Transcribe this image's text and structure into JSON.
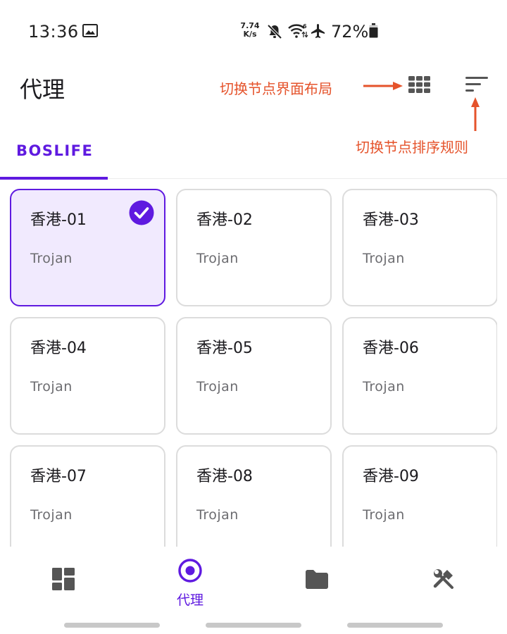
{
  "status_bar": {
    "time": "13:36",
    "net_speed_value": "7.74",
    "net_speed_unit": "K/s",
    "wifi_badge": "6",
    "battery_percent": "72%",
    "icons": [
      "gallery-icon",
      "mute-icon",
      "wifi-icon",
      "airplane-icon",
      "battery-icon"
    ]
  },
  "app_bar": {
    "title": "代理",
    "actions": [
      "grid-layout-icon",
      "sort-icon"
    ]
  },
  "annotations": {
    "layout_hint": "切换节点界面布局",
    "sort_hint": "切换节点排序规则"
  },
  "tabs": [
    {
      "label": "BOSLIFE",
      "selected": true
    }
  ],
  "proxies": [
    {
      "name": "香港-01",
      "type": "Trojan",
      "selected": true
    },
    {
      "name": "香港-02",
      "type": "Trojan",
      "selected": false
    },
    {
      "name": "香港-03",
      "type": "Trojan",
      "selected": false
    },
    {
      "name": "香港-04",
      "type": "Trojan",
      "selected": false
    },
    {
      "name": "香港-05",
      "type": "Trojan",
      "selected": false
    },
    {
      "name": "香港-06",
      "type": "Trojan",
      "selected": false
    },
    {
      "name": "香港-07",
      "type": "Trojan",
      "selected": false
    },
    {
      "name": "香港-08",
      "type": "Trojan",
      "selected": false
    },
    {
      "name": "香港-09",
      "type": "Trojan",
      "selected": false
    }
  ],
  "bottom_nav": [
    {
      "icon": "dashboard-icon",
      "label": "",
      "active": false
    },
    {
      "icon": "radio-target-icon",
      "label": "代理",
      "active": true
    },
    {
      "icon": "folder-icon",
      "label": "",
      "active": false
    },
    {
      "icon": "tools-icon",
      "label": "",
      "active": false
    }
  ],
  "colors": {
    "accent": "#5f1ae0",
    "selected_card_bg": "#f1eafe",
    "annotation": "#e5532b",
    "icon_gray": "#555555"
  }
}
